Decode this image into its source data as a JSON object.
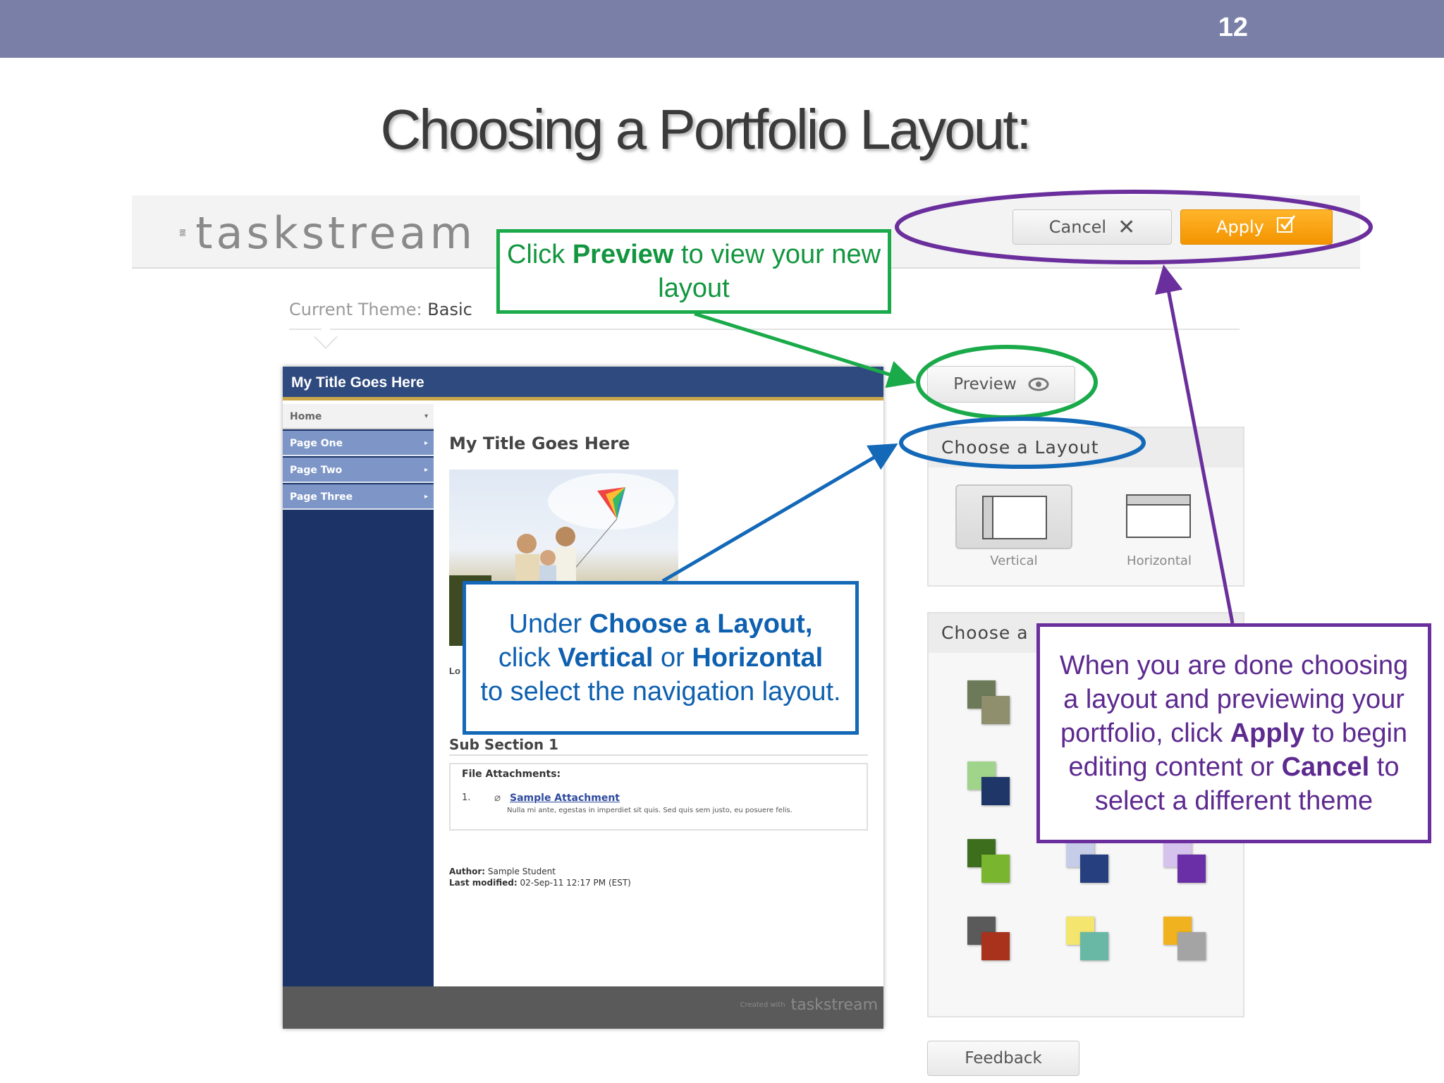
{
  "slide": {
    "number": "12",
    "title": "Choosing a Portfolio Layout:"
  },
  "app": {
    "logo_text": "taskstream",
    "cancel_label": "Cancel",
    "apply_label": "Apply",
    "current_theme_label": "Current Theme:",
    "current_theme_value": "Basic",
    "preview_label": "Preview",
    "feedback_label": "Feedback"
  },
  "layout_panel": {
    "title": "Choose a Layout",
    "options": [
      {
        "label": "Vertical",
        "selected": true
      },
      {
        "label": "Horizontal",
        "selected": false
      }
    ]
  },
  "colors_panel": {
    "title": "Choose a",
    "swatches": [
      {
        "a": "#6d7a5a",
        "b": "#8f8f6e"
      },
      {
        "a": "#9fd48a",
        "b": "#1e3668"
      },
      {
        "a": "#3c6e1e",
        "b": "#79b52e"
      },
      {
        "a": "#c5cde8",
        "b": "#263f7e"
      },
      {
        "a": "#d5c3ee",
        "b": "#6a2fa6"
      },
      {
        "a": "#5a5a5a",
        "b": "#a8321c"
      },
      {
        "a": "#f3e56e",
        "b": "#69b8a5"
      },
      {
        "a": "#f0b21e",
        "b": "#a4a4a4"
      }
    ]
  },
  "preview": {
    "header_title": "My Title Goes Here",
    "nav": [
      "Home",
      "Page One",
      "Page Two",
      "Page Three"
    ],
    "content_title": "My Title Goes Here",
    "lorem_fragment": "Lo",
    "sub_section": "Sub Section 1",
    "attachments_title": "File Attachments:",
    "attachment_number": "1.",
    "attachment_link": "Sample Attachment",
    "attachment_desc": "Nulla mi ante, egestas in imperdiet sit quis. Sed quis sem justo, eu posuere felis.",
    "meta_author_label": "Author:",
    "meta_author": "Sample Student",
    "meta_modified_label": "Last modified:",
    "meta_modified": "02-Sep-11 12:17 PM (EST)",
    "footer_created": "Created with",
    "footer_logo": "taskstream"
  },
  "callouts": {
    "green": {
      "pre": "Click ",
      "bold": "Preview",
      "post": " to view your new layout"
    },
    "blue": {
      "l1_pre": "Under ",
      "l1_bold": "Choose a Layout,",
      "l2_pre": "click ",
      "l2_bold1": "Vertical",
      "l2_mid": " or ",
      "l2_bold2": "Horizontal",
      "l3": "to select the navigation layout."
    },
    "purple": {
      "l1": "When you are done choosing a layout and previewing your portfolio, click ",
      "apply": "Apply",
      "l2": " to begin editing content or ",
      "cancel": "Cancel",
      "l3": " to select a different theme"
    }
  },
  "colors": {
    "topbar": "#7a7fa8",
    "green": "#1aaa4a",
    "blue": "#1368b8",
    "purple": "#6a2f9c",
    "apply_orange": "#f39400"
  }
}
